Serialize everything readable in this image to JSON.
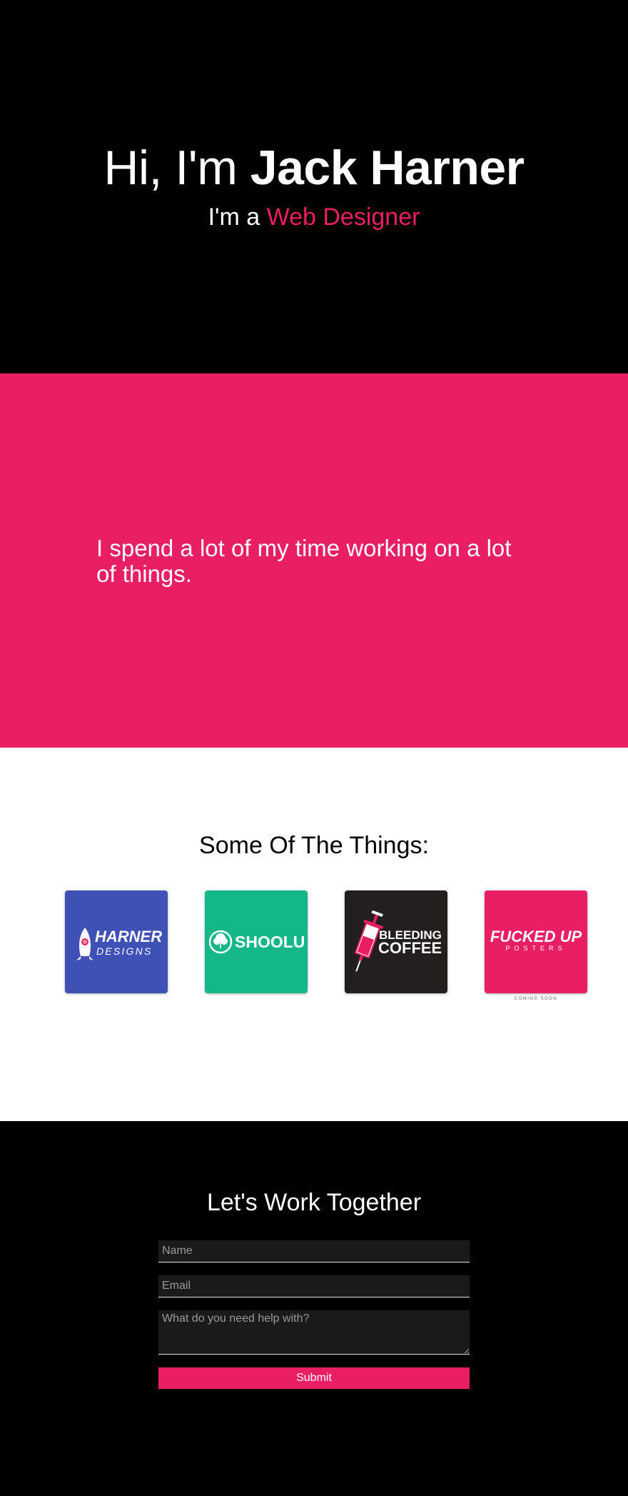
{
  "hero": {
    "greeting": "Hi, I'm ",
    "name": "Jack Harner",
    "subtitle_prefix": "I'm a ",
    "role": "Web Designer"
  },
  "about": {
    "text": "I spend a lot of my time working on a lot of things."
  },
  "things": {
    "title": "Some Of The Things:",
    "items": [
      {
        "name": "HARNER",
        "sub": "DESIGNS",
        "color": "#3f51b5",
        "icon": "rocket-icon"
      },
      {
        "name": "SHOOLU",
        "color": "#14b888",
        "icon": "tree-icon"
      },
      {
        "name": "BLEEDING",
        "sub": "COFFEE",
        "color": "#231f1e",
        "icon": "syringe-icon"
      },
      {
        "name": "FUCKED UP",
        "sub": "POSTERS",
        "color": "#e91e63",
        "caption": "COMING SOON"
      }
    ]
  },
  "contact": {
    "title": "Let's Work Together",
    "name_placeholder": "Name",
    "email_placeholder": "Email",
    "message_placeholder": "What do you need help with?",
    "submit_label": "Submit"
  },
  "colors": {
    "accent": "#e91e63",
    "background": "#000000",
    "text": "#ffffff"
  }
}
